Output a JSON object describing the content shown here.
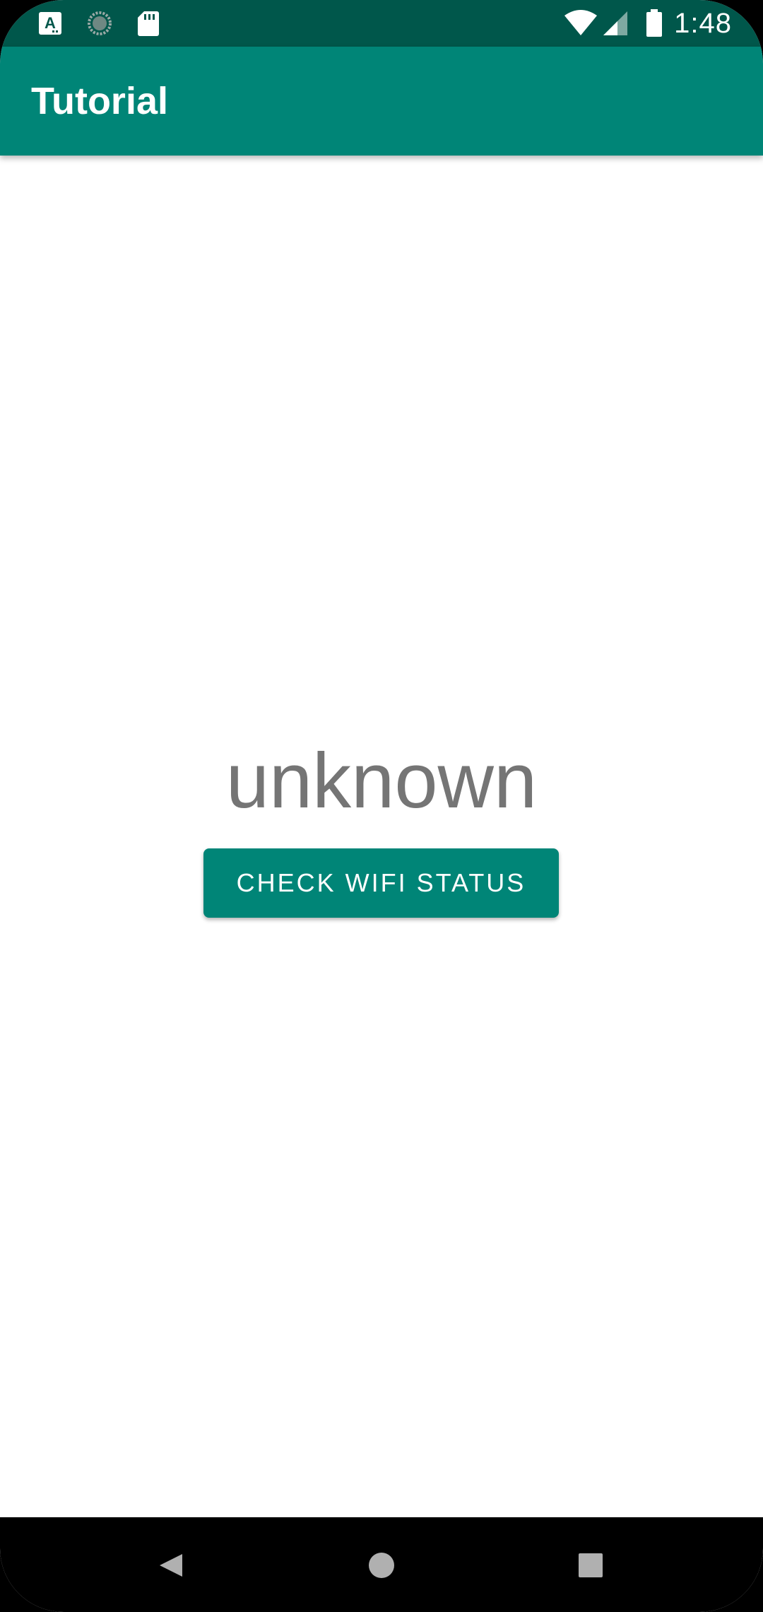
{
  "status_bar": {
    "time": "1:48",
    "icons_left": [
      "text-a-icon",
      "sync-icon",
      "sd-card-icon"
    ],
    "icons_right": [
      "wifi-icon",
      "cell-signal-icon",
      "battery-icon"
    ],
    "color": "#00574b"
  },
  "app_bar": {
    "title": "Tutorial",
    "color": "#008577"
  },
  "main": {
    "status_text": "unknown",
    "button_label": "CHECK WIFI STATUS"
  },
  "nav_bar": {
    "buttons": [
      "back-icon",
      "home-icon",
      "recents-icon"
    ]
  }
}
